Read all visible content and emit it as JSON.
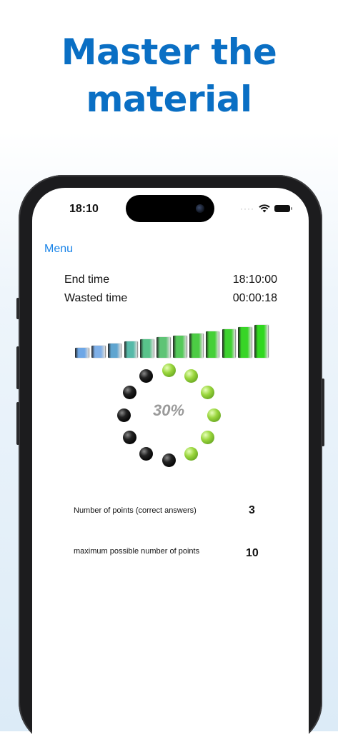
{
  "headline": {
    "line1": "Master the",
    "line2": "material"
  },
  "status_bar": {
    "time": "18:10",
    "signal": "····"
  },
  "nav": {
    "menu_label": "Menu"
  },
  "times": {
    "end_label": "End time",
    "end_value": "18:10:00",
    "wasted_label": "Wasted time",
    "wasted_value": "00:00:18"
  },
  "progress": {
    "percent_text": "30%",
    "fraction": 0.3,
    "active_color": "#9ad63d"
  },
  "level_bars": {
    "count": 12,
    "colors": [
      "#6ea7e6",
      "#7fb0e8",
      "#5fa5d0",
      "#57b9a8",
      "#58c38a",
      "#5ec476",
      "#55c95a",
      "#4ccc44",
      "#45d038",
      "#3ed22f",
      "#38d527",
      "#30d81f"
    ]
  },
  "stats": {
    "points_label": "Number of points (correct answers)",
    "points_value": "3",
    "max_label": "maximum possible number of points",
    "max_value": "10"
  }
}
